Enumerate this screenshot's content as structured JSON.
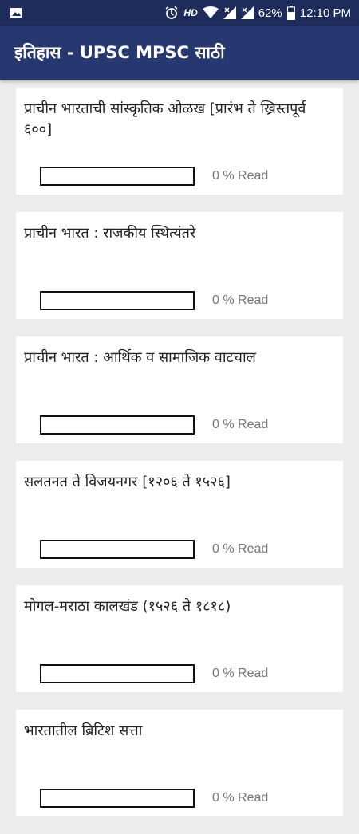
{
  "status_bar": {
    "hd": "HD",
    "battery": "62%",
    "time": "12:10 PM",
    "icons": [
      "image-icon",
      "alarm-icon",
      "wifi-icon",
      "signal-icon",
      "signal-icon",
      "battery-icon"
    ]
  },
  "app_bar": {
    "title": "इतिहास - UPSC MPSC साठी",
    "color": "#26386f"
  },
  "chapters": [
    {
      "title": "प्राचीन भारताची सांस्कृतिक ओळख [प्रारंभ ते ख्रिस्तपूर्व ६००]",
      "progress": 0,
      "progress_label": "0 % Read"
    },
    {
      "title": "प्राचीन भारत : राजकीय स्थित्यंतरे",
      "progress": 0,
      "progress_label": "0 % Read"
    },
    {
      "title": "प्राचीन भारत : आर्थिक व सामाजिक वाटचाल",
      "progress": 0,
      "progress_label": "0 % Read"
    },
    {
      "title": "सलतनत ते विजयनगर [१२०६ ते १५२६]",
      "progress": 0,
      "progress_label": "0 % Read"
    },
    {
      "title": "मोगल-मराठा कालखंड (१५२६ ते १८१८)",
      "progress": 0,
      "progress_label": "0 % Read"
    },
    {
      "title": "भारतातील ब्रिटिश सत्ता",
      "progress": 0,
      "progress_label": "0 % Read"
    }
  ]
}
